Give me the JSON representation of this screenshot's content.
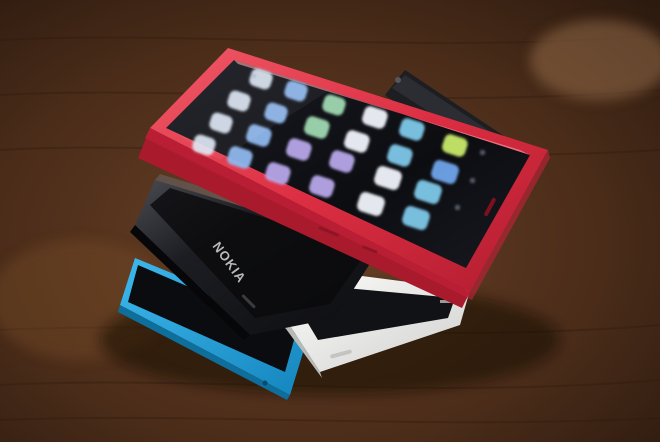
{
  "photo": {
    "subject": "stack-of-smartphones",
    "phones": [
      {
        "name": "red-phone",
        "color": "#e0344a"
      },
      {
        "name": "black-phone",
        "color": "#17171a",
        "brand_text": "NOKIA"
      },
      {
        "name": "white-phone",
        "color": "#e8e8e6"
      },
      {
        "name": "cyan-phone",
        "color": "#1e9fd6"
      },
      {
        "name": "back-black-phone",
        "color": "#1d1e22"
      }
    ],
    "surface": {
      "name": "wooden-table",
      "color": "#5a3620"
    },
    "icon_colors": [
      "#dfe9f7",
      "#8fb8ee",
      "#6fa5ea",
      "#9fd8b2",
      "#b7a6e8",
      "#f0f3fa",
      "#7ec8e8",
      "#c7e86a"
    ]
  }
}
